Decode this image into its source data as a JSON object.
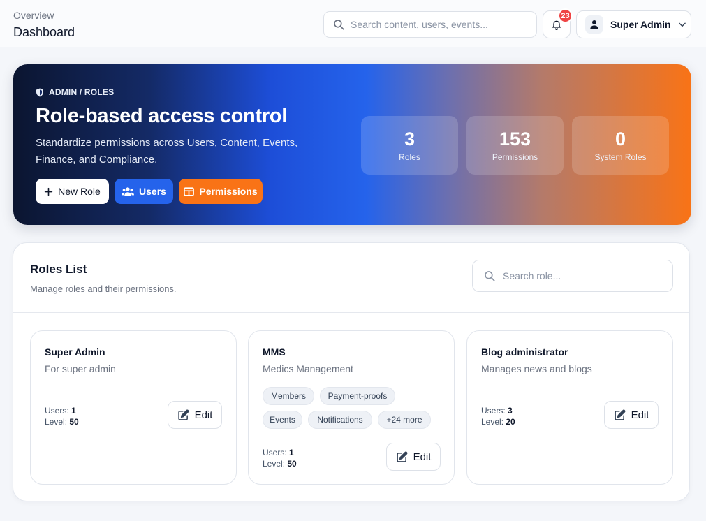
{
  "header": {
    "breadcrumb": "Overview",
    "title": "Dashboard",
    "search_placeholder": "Search content, users, events...",
    "notification_count": "23",
    "user_name": "Super Admin"
  },
  "hero": {
    "breadcrumb": "ADMIN / ROLES",
    "title": "Role-based access control",
    "subtitle": "Standardize permissions across Users, Content, Events, Finance, and Compliance.",
    "buttons": {
      "new_role": "New Role",
      "users": "Users",
      "permissions": "Permissions"
    },
    "stats": [
      {
        "value": "3",
        "label": "Roles"
      },
      {
        "value": "153",
        "label": "Permissions"
      },
      {
        "value": "0",
        "label": "System Roles"
      }
    ]
  },
  "roles_panel": {
    "title": "Roles List",
    "subtitle": "Manage roles and their permissions.",
    "search_placeholder": "Search role...",
    "users_label": "Users:",
    "level_label": "Level:",
    "edit_label": "Edit",
    "roles": [
      {
        "name": "Super Admin",
        "description": "For super admin",
        "users": "1",
        "level": "50",
        "permissions": []
      },
      {
        "name": "MMS",
        "description": "Medics Management",
        "users": "1",
        "level": "50",
        "permissions": [
          "Members",
          "Payment-proofs",
          "Events",
          "Notifications",
          "+24 more"
        ]
      },
      {
        "name": "Blog administrator",
        "description": "Manages news and blogs",
        "users": "3",
        "level": "20",
        "permissions": []
      }
    ]
  },
  "colors": {
    "primary_blue": "#2563eb",
    "accent_orange": "#f97316",
    "badge_red": "#ef4444",
    "hero_dark": "#0b1530"
  }
}
